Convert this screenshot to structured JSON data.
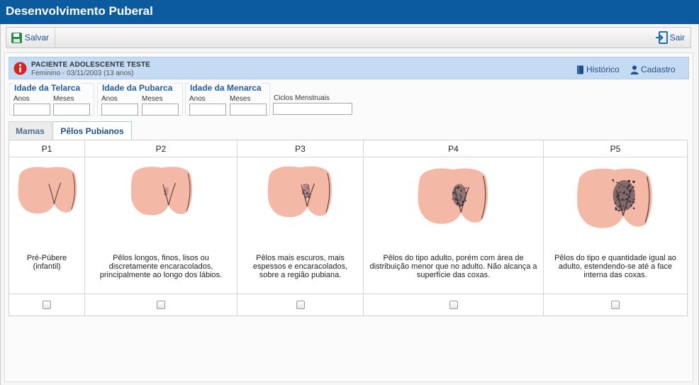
{
  "window": {
    "title": "Desenvolvimento Puberal"
  },
  "toolbar": {
    "save_label": "Salvar",
    "exit_label": "Sair"
  },
  "patient": {
    "name": "PACIENTE ADOLESCENTE TESTE",
    "details": "Feminino - 03/11/2003 (13 anos)",
    "history_label": "Histórico",
    "register_label": "Cadastro"
  },
  "ages": {
    "telarca": {
      "title": "Idade da Telarca",
      "years_label": "Anos",
      "months_label": "Meses",
      "years_value": "",
      "months_value": ""
    },
    "pubarca": {
      "title": "Idade da Pubarca",
      "years_label": "Anos",
      "months_label": "Meses",
      "years_value": "",
      "months_value": ""
    },
    "menarca": {
      "title": "Idade da Menarca",
      "years_label": "Anos",
      "months_label": "Meses",
      "years_value": "",
      "months_value": ""
    },
    "cycles": {
      "label": "Ciclos Menstruais",
      "value": ""
    }
  },
  "tabs": [
    {
      "label": "Mamas",
      "active": false
    },
    {
      "label": "Pêlos Pubianos",
      "active": true
    }
  ],
  "stages": [
    {
      "code": "P1",
      "description": "Pré-Púbere (infantil)",
      "checked": false,
      "hair_level": 0
    },
    {
      "code": "P2",
      "description": "Pêlos longos, finos, lisos ou discretamente encaracolados, principalmente ao longo dos lábios.",
      "checked": false,
      "hair_level": 1
    },
    {
      "code": "P3",
      "description": "Pêlos mais escuros, mais espessos e encaracolados, sobre a região pubiana.",
      "checked": false,
      "hair_level": 2
    },
    {
      "code": "P4",
      "description": "Pêlos do tipo adulto, porém com área de distribuição menor que no adulto. Não alcança a superfície das coxas.",
      "checked": false,
      "hair_level": 3
    },
    {
      "code": "P5",
      "description": "Pêlos do tipo e quantidade igual ao adulto, estendendo-se até a face interna das coxas.",
      "checked": false,
      "hair_level": 4
    }
  ],
  "colors": {
    "title_bar": "#0b5b9e",
    "skin": "#f4b8a6",
    "hair": "#2f2f3a",
    "patient_bar": "#c5dbf3",
    "info_icon": "#d9231d"
  }
}
